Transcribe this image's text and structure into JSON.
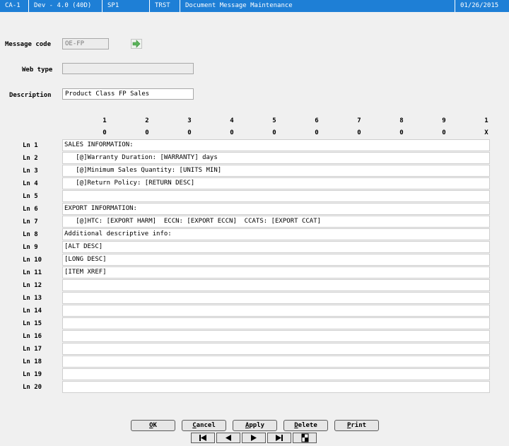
{
  "titlebar": [
    "CA-1",
    "Dev - 4.0 (40D)",
    "SP1",
    "TRST",
    "Document Message Maintenance",
    "01/26/2015"
  ],
  "form": {
    "message_code_label": "Message code",
    "message_code_value": "OE-FP",
    "web_type_label": "Web type",
    "web_type_value": "",
    "description_label": "Description",
    "description_value": "Product Class FP Sales"
  },
  "ruler": {
    "tens": [
      "1",
      "2",
      "3",
      "4",
      "5",
      "6",
      "7",
      "8",
      "9",
      "1"
    ],
    "units": [
      "0",
      "0",
      "0",
      "0",
      "0",
      "0",
      "0",
      "0",
      "0",
      "X"
    ]
  },
  "lines": [
    {
      "label": "Ln  1",
      "text": "SALES INFORMATION:"
    },
    {
      "label": "Ln  2",
      "text": "   [@]Warranty Duration: [WARRANTY] days"
    },
    {
      "label": "Ln  3",
      "text": "   [@]Minimum Sales Quantity: [UNITS MIN]"
    },
    {
      "label": "Ln  4",
      "text": "   [@]Return Policy: [RETURN DESC]"
    },
    {
      "label": "Ln  5",
      "text": ""
    },
    {
      "label": "Ln  6",
      "text": "EXPORT INFORMATION:"
    },
    {
      "label": "Ln  7",
      "text": "   [@]HTC: [EXPORT HARM]  ECCN: [EXPORT ECCN]  CCATS: [EXPORT CCAT]"
    },
    {
      "label": "Ln  8",
      "text": "Additional descriptive info:"
    },
    {
      "label": "Ln  9",
      "text": "[ALT DESC]"
    },
    {
      "label": "Ln 10",
      "text": "[LONG DESC]"
    },
    {
      "label": "Ln 11",
      "text": "[ITEM XREF]"
    },
    {
      "label": "Ln 12",
      "text": ""
    },
    {
      "label": "Ln 13",
      "text": ""
    },
    {
      "label": "Ln 14",
      "text": ""
    },
    {
      "label": "Ln 15",
      "text": ""
    },
    {
      "label": "Ln 16",
      "text": ""
    },
    {
      "label": "Ln 17",
      "text": ""
    },
    {
      "label": "Ln 18",
      "text": ""
    },
    {
      "label": "Ln 19",
      "text": ""
    },
    {
      "label": "Ln 20",
      "text": ""
    }
  ],
  "buttons": {
    "ok": {
      "u": "O",
      "rest": "K"
    },
    "cancel": {
      "u": "C",
      "rest": "ancel"
    },
    "apply": {
      "u": "A",
      "rest": "pply"
    },
    "delete": {
      "u": "D",
      "rest": "elete"
    },
    "print": {
      "u": "P",
      "rest": "rint"
    }
  },
  "nav_icons": [
    "first-record-icon",
    "previous-record-icon",
    "next-record-icon",
    "last-record-icon",
    "lookup-record-icon"
  ],
  "colors": {
    "titlebar": "#1e7fd6",
    "accent_arrow": "#5ab45a"
  }
}
